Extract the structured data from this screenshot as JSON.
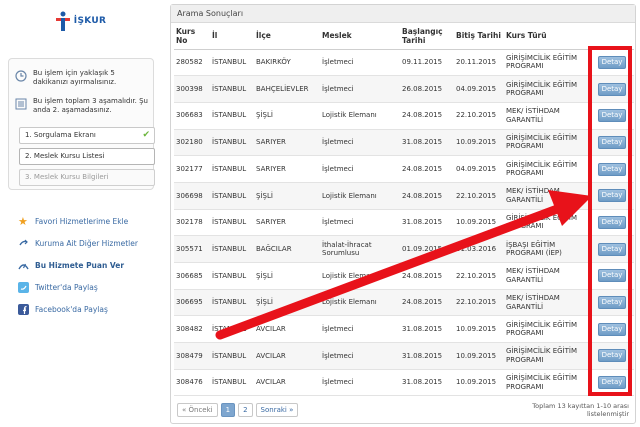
{
  "logo": {
    "text": "İŞKUR"
  },
  "info": {
    "line1": "Bu işlem için yaklaşık 5 dakikanızı ayırmalısınız.",
    "line2": "Bu işlem toplam 3 aşamalıdır. Şu anda 2. aşamadasınız."
  },
  "steps": [
    {
      "label": "1. Sorgulama Ekranı",
      "state": "done"
    },
    {
      "label": "2. Meslek Kursu Listesi",
      "state": "active"
    },
    {
      "label": "3. Meslek Kursu Bilgileri",
      "state": "pending"
    }
  ],
  "side_links": [
    {
      "label": "Favori Hizmetlerime Ekle",
      "icon": "star-icon"
    },
    {
      "label": "Kuruma Ait Diğer Hizmetler",
      "icon": "link-icon"
    },
    {
      "label": "Bu Hizmete Puan Ver",
      "icon": "rate-icon"
    },
    {
      "label": "Twitter'da Paylaş",
      "icon": "twitter-icon"
    },
    {
      "label": "Facebook'da Paylaş",
      "icon": "facebook-icon"
    }
  ],
  "results": {
    "title": "Arama Sonuçları",
    "headers": {
      "kurs_no": "Kurs No",
      "il": "İl",
      "ilce": "İlçe",
      "meslek": "Meslek",
      "baslangic": "Başlangıç Tarihi",
      "bitis": "Bitiş Tarihi",
      "kurs_turu": "Kurs Türü"
    },
    "button_label": "Detay",
    "rows": [
      [
        "280582",
        "İSTANBUL",
        "BAKIRKÖY",
        "İşletmeci",
        "09.11.2015",
        "20.11.2015",
        "GİRİŞİMCİLİK EĞİTİM PROGRAMI"
      ],
      [
        "300398",
        "İSTANBUL",
        "BAHÇELİEVLER",
        "İşletmeci",
        "26.08.2015",
        "04.09.2015",
        "GİRİŞİMCİLİK EĞİTİM PROGRAMI"
      ],
      [
        "306683",
        "İSTANBUL",
        "ŞİŞLİ",
        "Lojistik Elemanı",
        "24.08.2015",
        "22.10.2015",
        "MEK/ İSTİHDAM GARANTİLİ"
      ],
      [
        "302180",
        "İSTANBUL",
        "SARIYER",
        "İşletmeci",
        "31.08.2015",
        "10.09.2015",
        "GİRİŞİMCİLİK EĞİTİM PROGRAMI"
      ],
      [
        "302177",
        "İSTANBUL",
        "SARIYER",
        "İşletmeci",
        "24.08.2015",
        "04.09.2015",
        "GİRİŞİMCİLİK EĞİTİM PROGRAMI"
      ],
      [
        "306698",
        "İSTANBUL",
        "ŞİŞLİ",
        "Lojistik Elemanı",
        "24.08.2015",
        "22.10.2015",
        "MEK/ İSTİHDAM GARANTİLİ"
      ],
      [
        "302178",
        "İSTANBUL",
        "SARIYER",
        "İşletmeci",
        "31.08.2015",
        "10.09.2015",
        "GİRİŞİMCİLİK EĞİTİM PROGRAMI"
      ],
      [
        "305571",
        "İSTANBUL",
        "BAĞCILAR",
        "İthalat-İhracat Sorumlusu",
        "01.09.2015",
        "01.03.2016",
        "İŞBAŞI EĞİTİM PROGRAMI (İEP)"
      ],
      [
        "306685",
        "İSTANBUL",
        "ŞİŞLİ",
        "Lojistik Elemanı",
        "24.08.2015",
        "22.10.2015",
        "MEK/ İSTİHDAM GARANTİLİ"
      ],
      [
        "306695",
        "İSTANBUL",
        "ŞİŞLİ",
        "Lojistik Elemanı",
        "24.08.2015",
        "22.10.2015",
        "MEK/ İSTİHDAM GARANTİLİ"
      ],
      [
        "308482",
        "İSTANBUL",
        "AVCILAR",
        "İşletmeci",
        "31.08.2015",
        "10.09.2015",
        "GİRİŞİMCİLİK EĞİTİM PROGRAMI"
      ],
      [
        "308479",
        "İSTANBUL",
        "AVCILAR",
        "İşletmeci",
        "31.08.2015",
        "10.09.2015",
        "GİRİŞİMCİLİK EĞİTİM PROGRAMI"
      ],
      [
        "308476",
        "İSTANBUL",
        "AVCILAR",
        "İşletmeci",
        "31.08.2015",
        "10.09.2015",
        "GİRİŞİMCİLİK EĞİTİM PROGRAMI"
      ]
    ]
  },
  "pagination": {
    "prev": "« Önceki",
    "pages": [
      "1",
      "2"
    ],
    "current": "1",
    "next": "Sonraki »",
    "total": "Toplam 13 kayıttan 1-10 arası listelenmiştir"
  },
  "annotation_color": "#e8121a"
}
